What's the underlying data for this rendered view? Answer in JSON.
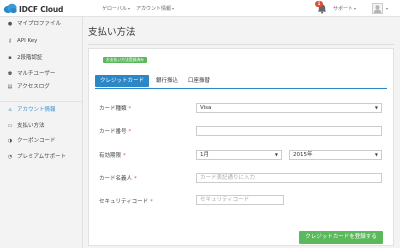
{
  "brand": {
    "logo_text": "IDCF Cloud"
  },
  "topnav": [
    {
      "label": "ゲローバル"
    },
    {
      "label": "アカウント情報"
    }
  ],
  "notifications": {
    "count": "1"
  },
  "support": {
    "label": "サポート"
  },
  "colors": {
    "accent": "#2b87c6",
    "success": "#5cb85c",
    "danger": "#e04a3a"
  },
  "sidebar": {
    "items": [
      {
        "label": "マイプロファイル",
        "icon": "user-icon"
      },
      {
        "label": "API Key",
        "icon": "key-icon"
      },
      {
        "label": "2段階認証",
        "icon": "lock-icon"
      },
      {
        "label": "マルチユーザー",
        "icon": "users-icon"
      },
      {
        "label": "アクセスログ",
        "icon": "log-icon"
      },
      {
        "label": "アカウント情報",
        "icon": "home-icon"
      },
      {
        "label": "支払い方法",
        "icon": "card-icon"
      },
      {
        "label": "クーポンコード",
        "icon": "coupon-icon"
      },
      {
        "label": "プレミアムサポート",
        "icon": "support-icon"
      }
    ]
  },
  "main": {
    "title": "支払い方法",
    "status_badge": "お支払い方法登録済み",
    "tabs": [
      {
        "label": "クレジットカード"
      },
      {
        "label": "銀行振込"
      },
      {
        "label": "口座振替"
      }
    ],
    "form": {
      "card_type": {
        "label": "カード種類",
        "value": "Visa"
      },
      "card_number": {
        "label": "カード番号",
        "value": ""
      },
      "expiry": {
        "label": "有効期限",
        "month": "1月",
        "year": "2015年"
      },
      "holder": {
        "label": "カード名義人",
        "placeholder": "カード表記通りに入力"
      },
      "security": {
        "label": "セキュリティコード",
        "placeholder": "セキュリティコード"
      },
      "required_mark": "*",
      "submit_label": "クレジットカードを登録する"
    }
  }
}
